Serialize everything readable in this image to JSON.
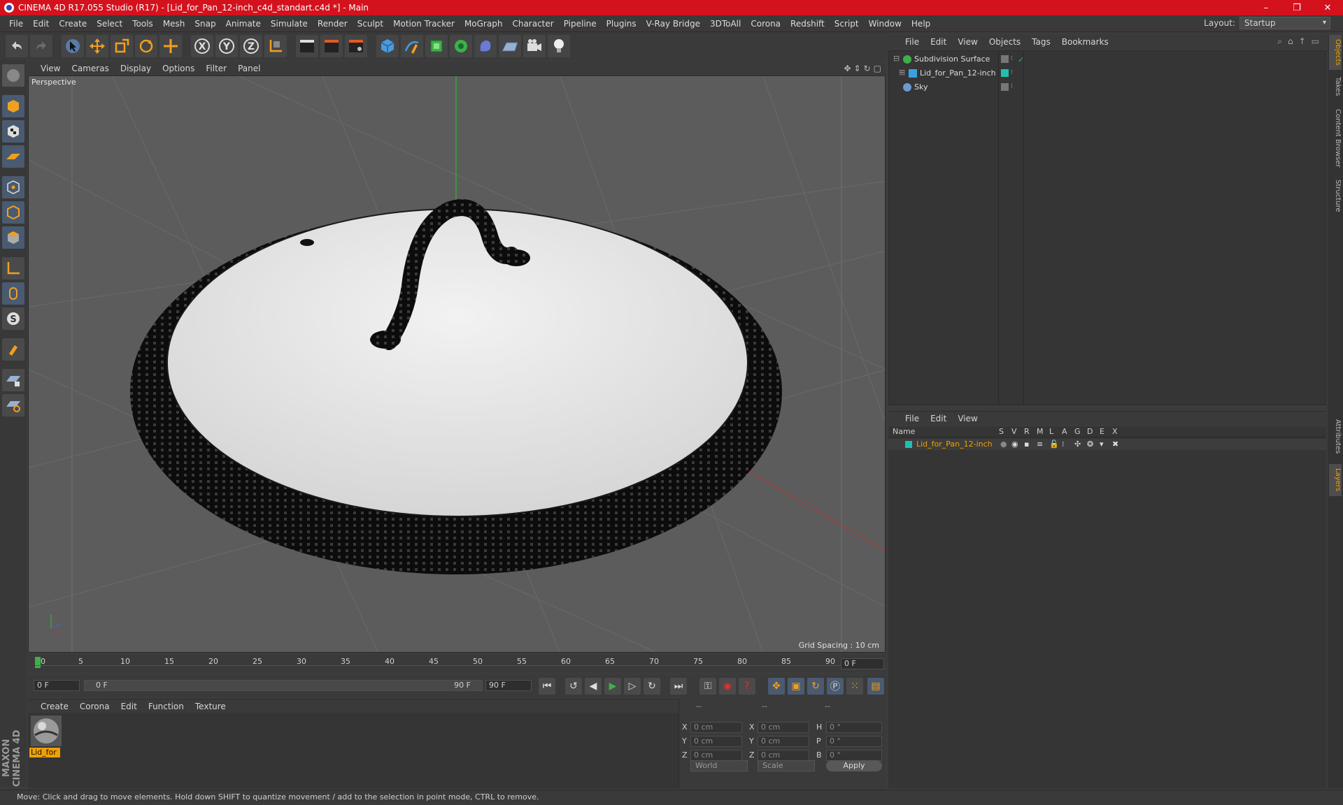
{
  "window": {
    "title": "CINEMA 4D R17.055 Studio (R17) - [Lid_for_Pan_12-inch_c4d_standart.c4d *] - Main",
    "controls": [
      "–",
      "❐",
      "✕"
    ]
  },
  "menubar": {
    "items": [
      "File",
      "Edit",
      "Create",
      "Select",
      "Tools",
      "Mesh",
      "Snap",
      "Animate",
      "Simulate",
      "Render",
      "Sculpt",
      "Motion Tracker",
      "MoGraph",
      "Character",
      "Pipeline",
      "Plugins",
      "V-Ray Bridge",
      "3DToAll",
      "Corona",
      "Redshift",
      "Script",
      "Window",
      "Help"
    ],
    "layout_label": "Layout:",
    "layout_value": "Startup"
  },
  "toolbar": {
    "axis_labels": [
      "X",
      "Y",
      "Z"
    ]
  },
  "viewport": {
    "menu": [
      "View",
      "Cameras",
      "Display",
      "Options",
      "Filter",
      "Panel"
    ],
    "camera_label": "Perspective",
    "grid_spacing": "Grid Spacing : 10 cm",
    "colors": {
      "background": "#5c5c5c",
      "x_axis": "#c03030",
      "y_axis": "#30c030"
    }
  },
  "timeline": {
    "ticks": [
      "0",
      "5",
      "10",
      "15",
      "20",
      "25",
      "30",
      "35",
      "40",
      "45",
      "50",
      "55",
      "60",
      "65",
      "70",
      "75",
      "80",
      "85",
      "90"
    ],
    "current_frame": "0 F",
    "start_field": "0 F",
    "range_start": "0 F",
    "range_end": "90 F",
    "end_field": "90 F"
  },
  "material_manager": {
    "menu": [
      "Create",
      "Corona",
      "Edit",
      "Function",
      "Texture"
    ],
    "materials": [
      {
        "name": "Lid_for"
      }
    ]
  },
  "coordinates": {
    "headers": [
      "--",
      "--",
      "--"
    ],
    "rows": [
      {
        "axis": "X",
        "pos": "0 cm",
        "size_axis": "X",
        "size": "0 cm",
        "rot_axis": "H",
        "rot": "0 °"
      },
      {
        "axis": "Y",
        "pos": "0 cm",
        "size_axis": "Y",
        "size": "0 cm",
        "rot_axis": "P",
        "rot": "0 °"
      },
      {
        "axis": "Z",
        "pos": "0 cm",
        "size_axis": "Z",
        "size": "0 cm",
        "rot_axis": "B",
        "rot": "0 °"
      }
    ],
    "mode_world": "World",
    "mode_scale": "Scale",
    "apply_label": "Apply"
  },
  "object_manager": {
    "menu": [
      "File",
      "Edit",
      "View",
      "Objects",
      "Tags",
      "Bookmarks"
    ],
    "objects": [
      {
        "name": "Subdivision Surface",
        "icon_color": "#3db04a"
      },
      {
        "name": "Lid_for_Pan_12-inch",
        "icon_color": "#3aa0e0"
      },
      {
        "name": "Sky",
        "icon_color": "#6a9ad0"
      }
    ]
  },
  "layer_manager": {
    "menu": [
      "File",
      "Edit",
      "View"
    ],
    "columns": [
      "Name",
      "S",
      "V",
      "R",
      "M",
      "L",
      "A",
      "G",
      "D",
      "E",
      "X"
    ],
    "layers": [
      {
        "name": "Lid_for_Pan_12-inch",
        "color": "#20c0b0"
      }
    ]
  },
  "right_tabs": [
    "Objects",
    "Takes",
    "Content Browser",
    "Structure",
    "Attributes",
    "Layers"
  ],
  "status": "Move: Click and drag to move elements. Hold down SHIFT to quantize movement / add to the selection in point mode, CTRL to remove.",
  "branding": "MAXON CINEMA 4D"
}
